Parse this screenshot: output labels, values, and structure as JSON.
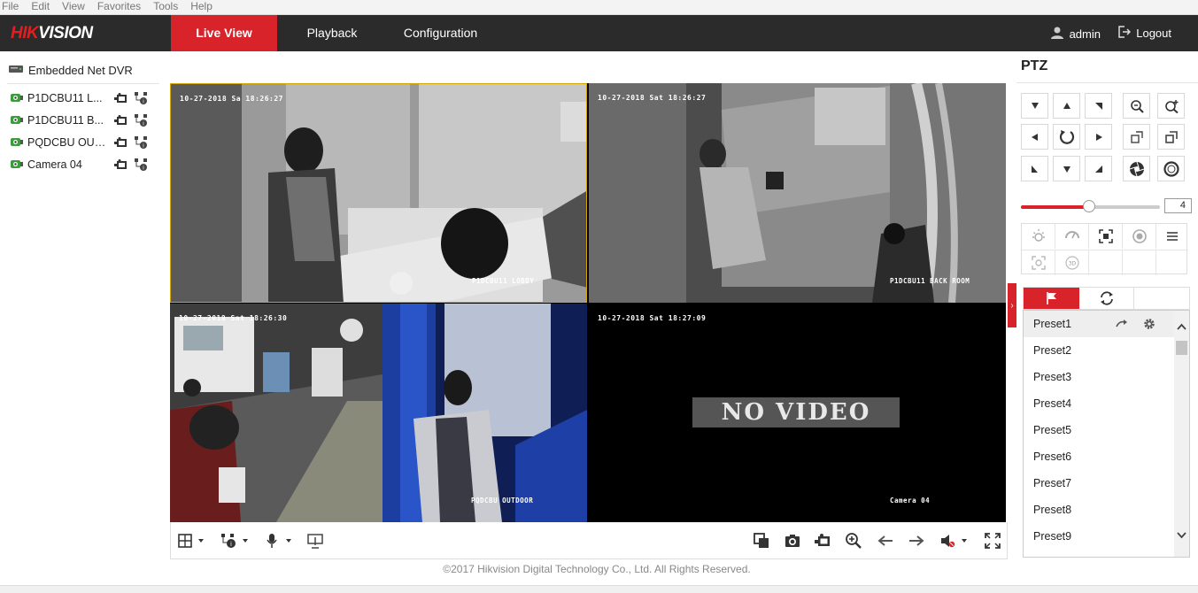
{
  "browser_menu": [
    "File",
    "Edit",
    "View",
    "Favorites",
    "Tools",
    "Help"
  ],
  "brand": {
    "logo_red": "HIK",
    "logo_white": "VISION",
    "accent_color": "#d8232a",
    "nav_bg": "#2b2b2b"
  },
  "nav": {
    "tabs": [
      "Live View",
      "Playback",
      "Configuration"
    ],
    "active": "Live View"
  },
  "user": {
    "name": "admin",
    "logout_label": "Logout"
  },
  "tree": {
    "root": "Embedded Net DVR",
    "cameras": [
      {
        "label": "P1DCBU11 L..."
      },
      {
        "label": "P1DCBU11 B..."
      },
      {
        "label": "PQDCBU OUT..."
      },
      {
        "label": "Camera 04"
      }
    ]
  },
  "video": {
    "tiles": [
      {
        "timestamp": "10-27-2018 Sa  18:26:27",
        "camera_name": "P1DCBU11 LOBBY"
      },
      {
        "timestamp": "10-27-2018 Sat 18:26:27",
        "camera_name": "P1DCBU11 BACK ROOM"
      },
      {
        "timestamp": "10-27-2018 Sat 18:26:30",
        "camera_name": "PQDCBU OUTDOOR"
      },
      {
        "timestamp": "10-27-2018 Sat 18:27:09",
        "camera_name": "Camera 04",
        "no_video_text": "NO VIDEO"
      }
    ]
  },
  "toolbar": {
    "left_icons": [
      "window-split-icon",
      "ptz-control-icon",
      "microphone-icon",
      "digital-zoom-icon"
    ],
    "right_icons": [
      "stop-all-icon",
      "capture-icon",
      "record-icon",
      "zoom-in-icon",
      "prev-page-icon",
      "next-page-icon",
      "volume-icon",
      "fullscreen-icon"
    ]
  },
  "footer": {
    "copyright": "©2017 Hikvision Digital Technology Co., Ltd. All Rights Reserved."
  },
  "ptz": {
    "title": "PTZ",
    "speed": "4",
    "speed_fraction": 0.49,
    "presets": [
      "Preset1",
      "Preset2",
      "Preset3",
      "Preset4",
      "Preset5",
      "Preset6",
      "Preset7",
      "Preset8",
      "Preset9"
    ],
    "selected_preset": "Preset1"
  }
}
